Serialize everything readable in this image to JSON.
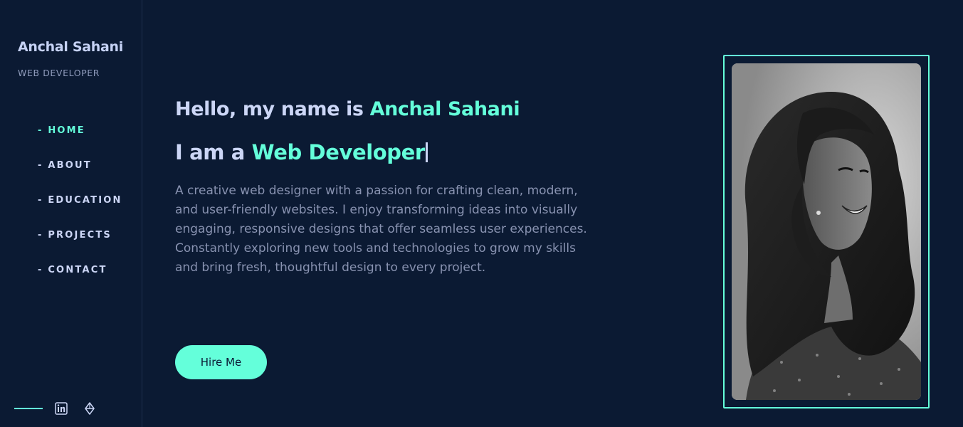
{
  "sidebar": {
    "name": "Anchal Sahani",
    "role": "WEB DEVELOPER",
    "nav": [
      {
        "label": "- HOME",
        "active": true
      },
      {
        "label": "- ABOUT",
        "active": false
      },
      {
        "label": "- EDUCATION",
        "active": false
      },
      {
        "label": "- PROJECTS",
        "active": false
      },
      {
        "label": "- CONTACT",
        "active": false
      }
    ],
    "social_icons": [
      "linkedin-icon",
      "codepen-icon"
    ]
  },
  "hero": {
    "greeting_prefix": "Hello, my name is ",
    "greeting_name": "Anchal Sahani",
    "iam_prefix": "I am a ",
    "iam_role": "Web Developer",
    "intro": "A creative web designer with a passion for crafting clean, modern, and user-friendly websites. I enjoy transforming ideas into visually engaging, responsive designs that offer seamless user experiences. Constantly exploring new tools and technologies to grow my skills and bring fresh, thoughtful design to every project.",
    "cta_label": "Hire Me"
  },
  "colors": {
    "background": "#0b1a33",
    "accent": "#64ffda",
    "heading": "#ccd6f6",
    "body_text": "#8892b0"
  }
}
